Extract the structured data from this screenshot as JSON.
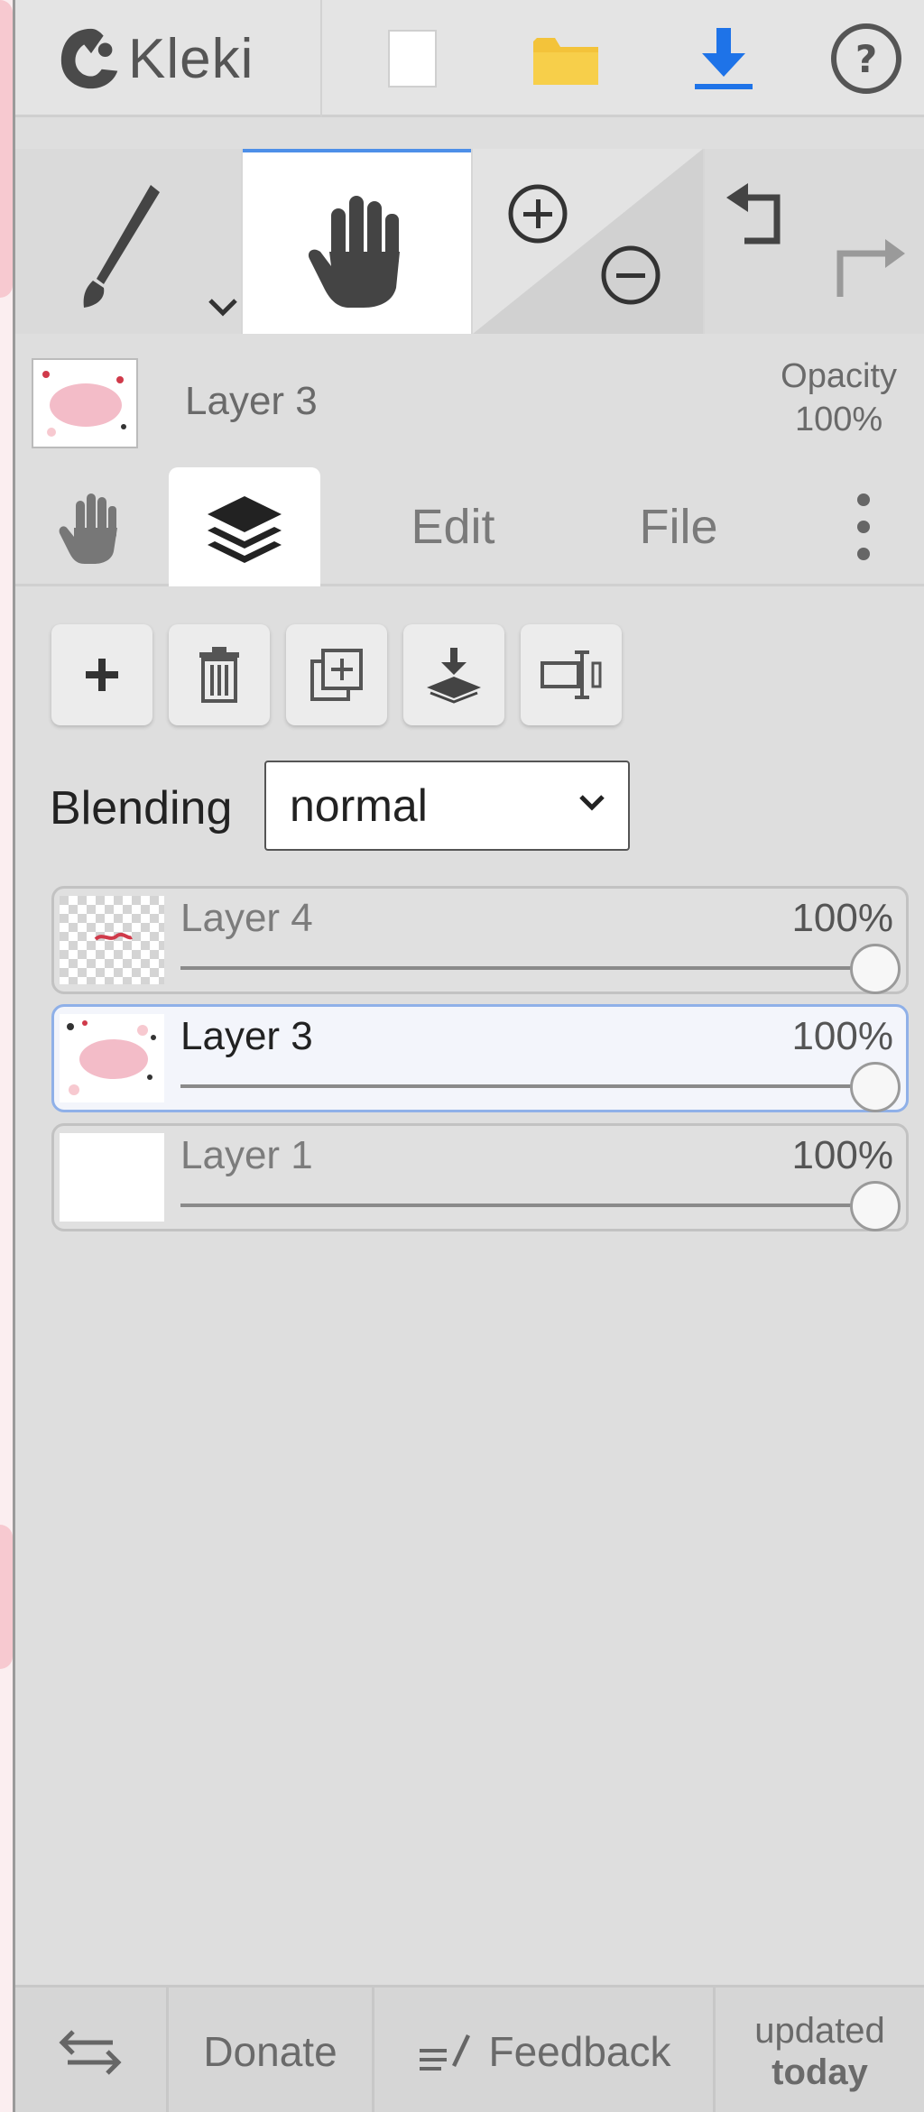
{
  "app": {
    "logo_text": "Kleki"
  },
  "topbar": {
    "icons": [
      "new-image-icon",
      "open-folder-icon",
      "download-icon",
      "help-icon"
    ],
    "colors": {
      "folder": "#f3c33a",
      "download": "#1e73e8"
    }
  },
  "toolbar": {
    "tools": [
      "brush-tool",
      "hand-tool",
      "zoom-tool",
      "undo-redo"
    ],
    "active_tool": "hand-tool",
    "accent_color": "#4d8fe8"
  },
  "layer_info": {
    "name": "Layer 3",
    "opacity_label": "Opacity",
    "opacity_value": "100%"
  },
  "tabs": {
    "edit_label": "Edit",
    "file_label": "File",
    "active": "layers"
  },
  "layer_actions": [
    "add-layer-icon",
    "delete-layer-icon",
    "duplicate-layer-icon",
    "merge-down-icon",
    "rename-layer-icon"
  ],
  "blending": {
    "label": "Blending",
    "value": "normal"
  },
  "layers": [
    {
      "name": "Layer 4",
      "opacity": "100%",
      "active": false
    },
    {
      "name": "Layer 3",
      "opacity": "100%",
      "active": true
    },
    {
      "name": "Layer 1",
      "opacity": "100%",
      "active": false
    }
  ],
  "bottombar": {
    "donate": "Donate",
    "feedback": "Feedback",
    "updated_line1": "updated",
    "updated_line2": "today"
  }
}
